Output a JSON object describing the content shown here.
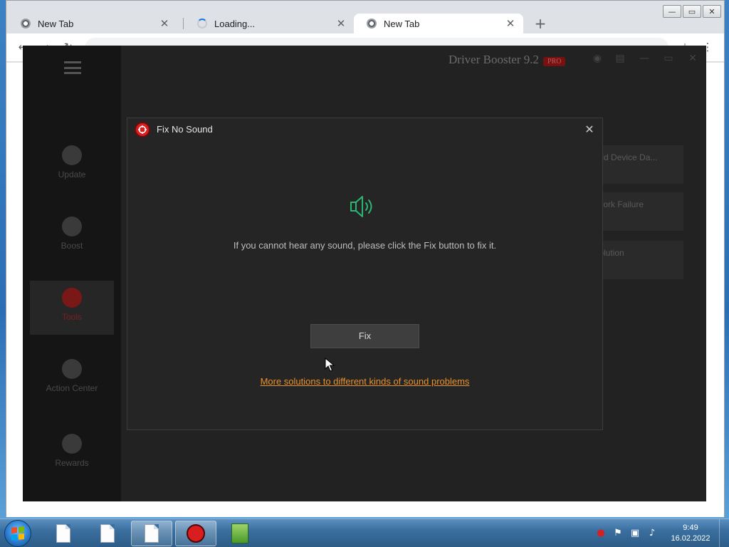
{
  "browser": {
    "tabs": [
      {
        "title": "New Tab",
        "state": "normal"
      },
      {
        "title": "Loading...",
        "state": "loading"
      },
      {
        "title": "New Tab",
        "state": "active"
      }
    ],
    "window_controls": {
      "minimize": "—",
      "restore": "▭",
      "close": "✕"
    },
    "new_tab": "+"
  },
  "app": {
    "title": "Driver Booster 9.2",
    "sidebar": [
      "Update",
      "Boost",
      "Tools",
      "Action Center",
      "Rewards"
    ],
    "cards": [
      "Invalid Device Da...",
      "Network Failure",
      "Resolution"
    ]
  },
  "modal": {
    "title": "Fix No Sound",
    "close_glyph": "✕",
    "icon": "speaker-icon",
    "message": "If you cannot hear any sound, please click the Fix button to fix it.",
    "fix_label": "Fix",
    "more_link": "More solutions to different kinds of sound problems"
  },
  "taskbar": {
    "time": "9:49",
    "date": "16.02.2022"
  },
  "colors": {
    "accent_link": "#e8922c",
    "speaker_green": "#2bb673",
    "brand_red": "#d81e1e",
    "modal_bg": "#252525"
  }
}
